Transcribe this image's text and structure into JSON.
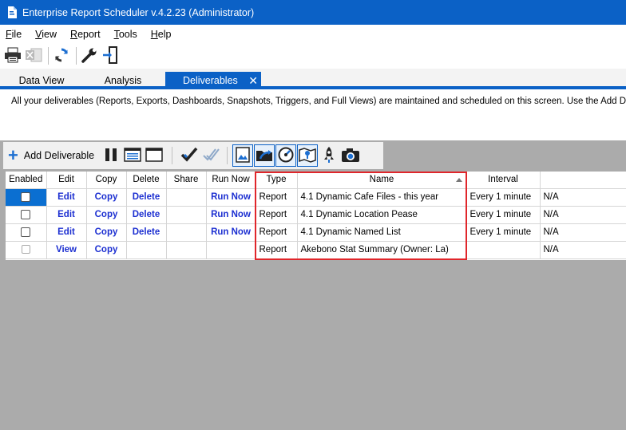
{
  "window": {
    "title": "Enterprise Report Scheduler v.4.2.23 (Administrator)"
  },
  "menu": [
    {
      "label": "File",
      "accel": "F",
      "rest": "ile"
    },
    {
      "label": "View",
      "accel": "V",
      "rest": "iew"
    },
    {
      "label": "Report",
      "accel": "R",
      "rest": "eport"
    },
    {
      "label": "Tools",
      "accel": "T",
      "rest": "ools"
    },
    {
      "label": "Help",
      "accel": "H",
      "rest": "elp"
    }
  ],
  "toolbar1": {
    "icons": [
      "printer-icon",
      "excel-icon",
      "refresh-icon",
      "wrench-icon",
      "exit-icon"
    ]
  },
  "tabs": [
    {
      "label": "Data View"
    },
    {
      "label": "Analysis"
    },
    {
      "label": "Deliverables",
      "close": "✕"
    }
  ],
  "info": {
    "text": "All your deliverables (Reports, Exports, Dashboards, Snapshots, Triggers, and Full Views) are maintained and scheduled on this screen. Use the Add Deliverable button"
  },
  "toolbar2": {
    "add_label": "Add Deliverable",
    "add_symbol": "+"
  },
  "grid": {
    "columns": [
      "Enabled",
      "Edit",
      "Copy",
      "Delete",
      "Share",
      "Run Now",
      "Type",
      "Name",
      "Interval",
      ""
    ],
    "rows": [
      {
        "edit": "Edit",
        "copy": "Copy",
        "delete": "Delete",
        "share": "",
        "run": "Run Now",
        "type": "Report",
        "name": "4.1 Dynamic Cafe Files - this year",
        "interval": "Every 1 minute",
        "status": "N/A"
      },
      {
        "edit": "Edit",
        "copy": "Copy",
        "delete": "Delete",
        "share": "",
        "run": "Run Now",
        "type": "Report",
        "name": "4.1 Dynamic Location Pease",
        "interval": "Every 1 minute",
        "status": "N/A"
      },
      {
        "edit": "Edit",
        "copy": "Copy",
        "delete": "Delete",
        "share": "",
        "run": "Run Now",
        "type": "Report",
        "name": "4.1 Dynamic Named List",
        "interval": "Every 1 minute",
        "status": "N/A"
      },
      {
        "edit": "View",
        "copy": "Copy",
        "delete": "",
        "share": "",
        "run": "",
        "type": "Report",
        "name": "Akebono Stat Summary (Owner: La)",
        "interval": "",
        "status": "N/A"
      }
    ]
  },
  "colors": {
    "accent": "#0b61c6",
    "link": "#1c2fd1",
    "highlight": "#e0262b",
    "background": "#ababab"
  }
}
